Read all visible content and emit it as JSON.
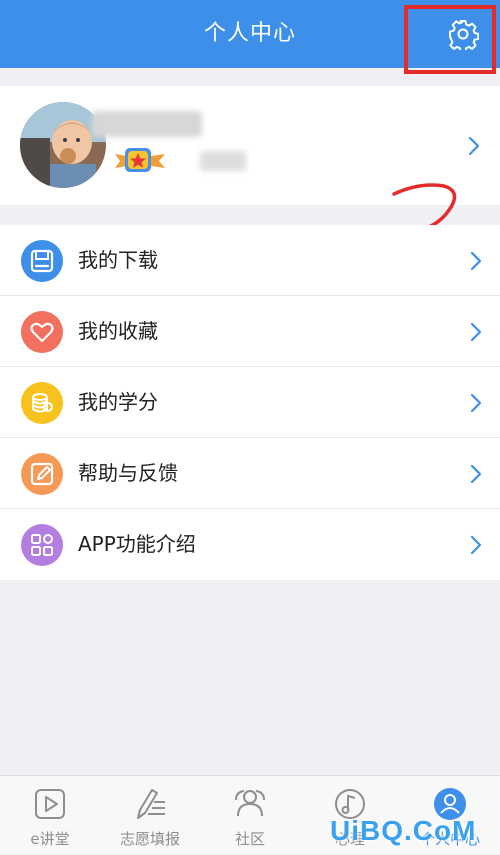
{
  "header": {
    "title": "个人中心"
  },
  "menu": {
    "items": [
      {
        "label": "我的下载",
        "icon": "download-icon",
        "color": "#3d8fea"
      },
      {
        "label": "我的收藏",
        "icon": "heart-icon",
        "color": "#f2705e"
      },
      {
        "label": "我的学分",
        "icon": "coins-icon",
        "color": "#f7c21e"
      },
      {
        "label": "帮助与反馈",
        "icon": "edit-icon",
        "color": "#f59a55"
      },
      {
        "label": "APP功能介绍",
        "icon": "apps-icon",
        "color": "#b37ee0"
      }
    ]
  },
  "tabbar": {
    "tabs": [
      {
        "label": "e讲堂",
        "icon": "play-icon"
      },
      {
        "label": "志愿填报",
        "icon": "pen-icon"
      },
      {
        "label": "社区",
        "icon": "community-icon"
      },
      {
        "label": "心理",
        "icon": "music-note-icon"
      },
      {
        "label": "个人中心",
        "icon": "person-icon",
        "active": true
      }
    ]
  },
  "watermark": "UiBQ.CoM",
  "colors": {
    "primary": "#3d8fea",
    "annotation": "#e32b2b"
  }
}
